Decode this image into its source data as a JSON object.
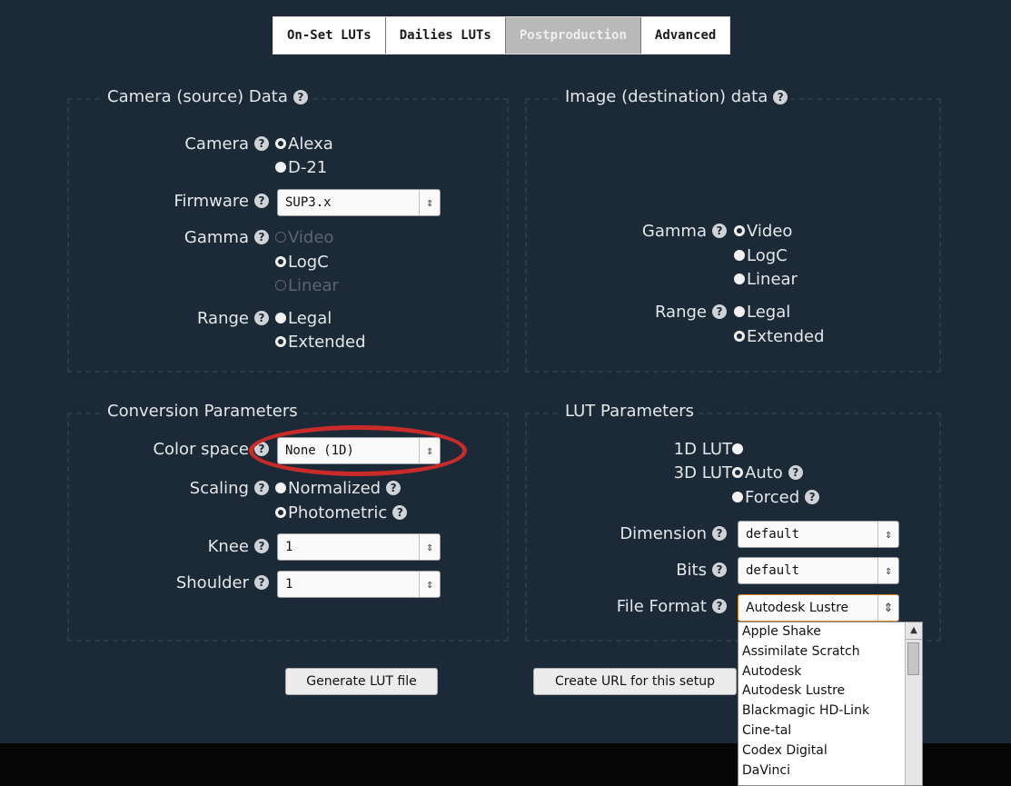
{
  "tabs": [
    "On-Set LUTs",
    "Dailies LUTs",
    "Postproduction",
    "Advanced"
  ],
  "active_tab": "Postproduction",
  "camera_panel": {
    "title": "Camera (source) Data",
    "camera_label": "Camera",
    "camera_options": [
      "Alexa",
      "D-21"
    ],
    "firmware_label": "Firmware",
    "firmware_value": "SUP3.x",
    "gamma_label": "Gamma",
    "gamma_options": [
      "Video",
      "LogC",
      "Linear"
    ],
    "range_label": "Range",
    "range_options": [
      "Legal",
      "Extended"
    ]
  },
  "image_panel": {
    "title": "Image (destination) data",
    "gamma_label": "Gamma",
    "gamma_options": [
      "Video",
      "LogC",
      "Linear"
    ],
    "range_label": "Range",
    "range_options": [
      "Legal",
      "Extended"
    ]
  },
  "conversion_panel": {
    "title": "Conversion Parameters",
    "color_space_label": "Color space",
    "color_space_value": "None (1D)",
    "scaling_label": "Scaling",
    "scaling_options": [
      "Normalized",
      "Photometric"
    ],
    "knee_label": "Knee",
    "knee_value": "1",
    "shoulder_label": "Shoulder",
    "shoulder_value": "1"
  },
  "lut_panel": {
    "title": "LUT Parameters",
    "lut1d_label": "1D LUT",
    "lut3d_label": "3D LUT",
    "lut3d_options": [
      "Auto",
      "Forced"
    ],
    "dimension_label": "Dimension",
    "dimension_value": "default",
    "bits_label": "Bits",
    "bits_value": "default",
    "file_format_label": "File Format",
    "file_format_value": "Autodesk Lustre"
  },
  "buttons": {
    "generate": "Generate LUT file",
    "create_url": "Create URL for this setup"
  },
  "file_format_dropdown": [
    "Apple Shake",
    "Assimilate Scratch",
    "Autodesk",
    "Autodesk Lustre",
    "Blackmagic HD-Link",
    "Cine-tal",
    "Codex Digital",
    "DaVinci"
  ],
  "help_icon_glyph": "?",
  "select_arrow_glyph": "⇕",
  "colors": {
    "background": "#1b2a36",
    "highlight_ring": "#c92b2b",
    "active_tab": "#b9b9b9",
    "focus_border": "#d9892c"
  }
}
